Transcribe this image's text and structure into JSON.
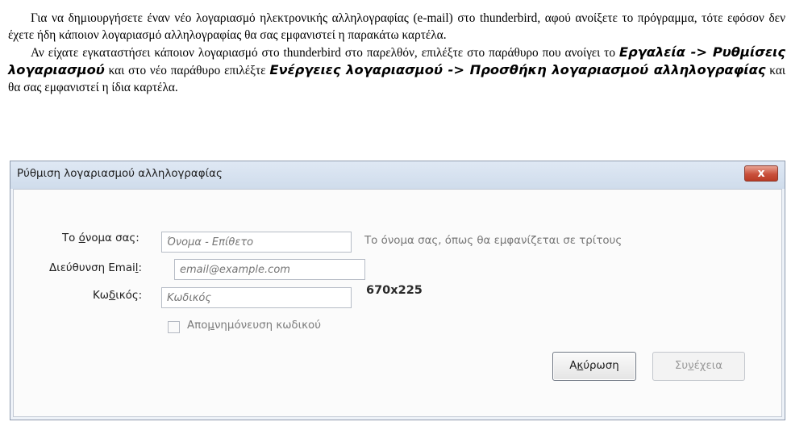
{
  "document": {
    "p1": "Για να δημιουργήσετε έναν νέο λογαριασμό ηλεκτρονικής αλληλογραφίας (e-mail) στο thunderbird, αφού ανοίξετε το πρόγραμμα, τότε εφόσον δεν έχετε ήδη κάποιον λογαριασμό αλληλογραφίας θα σας εμφανιστεί η παρακάτω καρτέλα.",
    "p2_a": "Αν είχατε εγκαταστήσει κάποιον λογαριασμό στο thunderbird στο παρελθόν, επιλέξτε στο παράθυρο που ανοίγει το ",
    "p2_b": "Εργαλεία -> Ρυθμίσεις λογαριασμού",
    "p2_c": " και στο νέο παράθυρο επιλέξτε ",
    "p2_d": "Ενέργειες λογαριασμού -> Προσθήκη λογαριασμού αλληλογραφίας",
    "p2_e": " και θα σας εμφανιστεί η ίδια καρτέλα."
  },
  "dialog": {
    "title": "Ρύθμιση λογαριασμού αλληλογραφίας",
    "close_label": "x",
    "name_label_pre": "Το ",
    "name_label_u": "ό",
    "name_label_post": "νομα σας:",
    "name_placeholder": "Όνομα - Επίθετο",
    "name_hint": "Το όνομα σας, όπως θα εμφανίζεται σε τρίτους",
    "email_label_pre": "Διεύθυνση Emai",
    "email_label_u": "l",
    "email_label_post": ":",
    "email_placeholder": "email@example.com",
    "dims_text": "670x225",
    "password_label_pre": "Κω",
    "password_label_u": "δ",
    "password_label_post": "ικός:",
    "password_placeholder": "Κωδικός",
    "remember_pre": "Απο",
    "remember_u": "μ",
    "remember_post": "νημόνευση κωδικού",
    "cancel_pre": "Α",
    "cancel_u": "κ",
    "cancel_post": "ύρωση",
    "continue_pre": "Συ",
    "continue_u": "ν",
    "continue_post": "έχεια"
  }
}
